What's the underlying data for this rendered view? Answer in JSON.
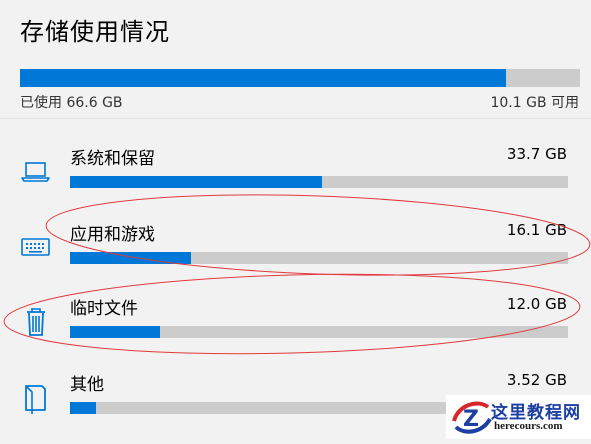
{
  "page": {
    "title": "存储使用情况"
  },
  "total": {
    "used_label": "已使用 66.6 GB",
    "free_label": "10.1 GB 可用",
    "used_fraction": 0.868
  },
  "categories": [
    {
      "label": "系统和保留",
      "size": "33.7 GB",
      "fraction": 0.507,
      "icon": "laptop-icon"
    },
    {
      "label": "应用和游戏",
      "size": "16.1 GB",
      "fraction": 0.242,
      "icon": "keyboard-icon"
    },
    {
      "label": "临时文件",
      "size": "12.0 GB",
      "fraction": 0.181,
      "icon": "trash-icon"
    },
    {
      "label": "其他",
      "size": "3.52 GB",
      "fraction": 0.053,
      "icon": "folder-icon"
    }
  ],
  "watermark": {
    "title": "这里教程网",
    "url": "herecours.com"
  },
  "colors": {
    "accent": "#0078d7",
    "track": "#cccccc",
    "annotation": "#e0393e",
    "background": "#f2f2f2"
  }
}
